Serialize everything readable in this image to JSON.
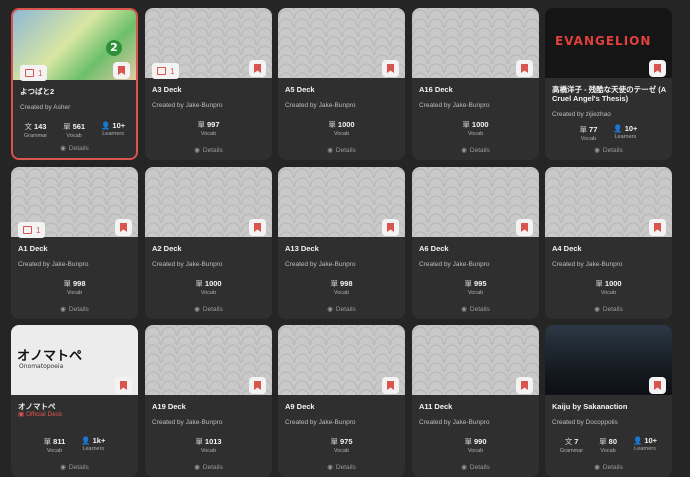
{
  "ui": {
    "created_by_prefix": "Created by ",
    "details_label": "Details",
    "grammar_label": "Grammar",
    "vocab_label": "Vocab",
    "learners_label": "Learners"
  },
  "icons": {
    "bookmark": "bookmark-icon",
    "comment": "comment-icon",
    "eye": "eye-icon",
    "person": "person-icon",
    "stamp": "stamp-icon"
  },
  "colors": {
    "accent": "#d9534f",
    "background": "#252525",
    "card": "#2f2f2f"
  },
  "decks": [
    {
      "title": "よつばと2",
      "author": "Asher",
      "comments": "1",
      "grammar": "143",
      "vocab": "561",
      "learners": "10+",
      "cover": "yotsuba",
      "cover_text": "2",
      "selected": true
    },
    {
      "title": "A3 Deck",
      "author": "Jake-Bunpro",
      "comments": "1",
      "vocab": "997",
      "cover": "pattern"
    },
    {
      "title": "A5 Deck",
      "author": "Jake-Bunpro",
      "vocab": "1000",
      "cover": "pattern"
    },
    {
      "title": "A16 Deck",
      "author": "Jake-Bunpro",
      "vocab": "1000",
      "cover": "pattern"
    },
    {
      "title": "高橋洋子 - 残酷な天使のテーゼ (A Cruel Angel's Thesis)",
      "author": "zijiezhao",
      "vocab": "77",
      "learners": "10+",
      "cover": "eva",
      "cover_text": "EVANGELION"
    },
    {
      "title": "A1 Deck",
      "author": "Jake-Bunpro",
      "comments": "1",
      "vocab": "998",
      "cover": "pattern"
    },
    {
      "title": "A2 Deck",
      "author": "Jake-Bunpro",
      "vocab": "1000",
      "cover": "pattern"
    },
    {
      "title": "A13 Deck",
      "author": "Jake-Bunpro",
      "vocab": "998",
      "cover": "pattern"
    },
    {
      "title": "A6 Deck",
      "author": "Jake-Bunpro",
      "vocab": "995",
      "cover": "pattern"
    },
    {
      "title": "A4 Deck",
      "author": "Jake-Bunpro",
      "vocab": "1000",
      "cover": "pattern"
    },
    {
      "title": "オノマトペ",
      "official": "Official Deck",
      "vocab": "811",
      "learners": "1k+",
      "cover": "ono",
      "cover_text": "オノマトペ",
      "cover_subtext": "Onomatopoeia"
    },
    {
      "title": "A19 Deck",
      "author": "Jake-Bunpro",
      "vocab": "1013",
      "cover": "pattern"
    },
    {
      "title": "A9 Deck",
      "author": "Jake-Bunpro",
      "vocab": "975",
      "cover": "pattern"
    },
    {
      "title": "A11 Deck",
      "author": "Jake-Bunpro",
      "vocab": "990",
      "cover": "pattern"
    },
    {
      "title": "Kaiju by Sakanaction",
      "author": "Docoppolis",
      "grammar": "7",
      "vocab": "80",
      "learners": "10+",
      "cover": "kaiju"
    }
  ]
}
